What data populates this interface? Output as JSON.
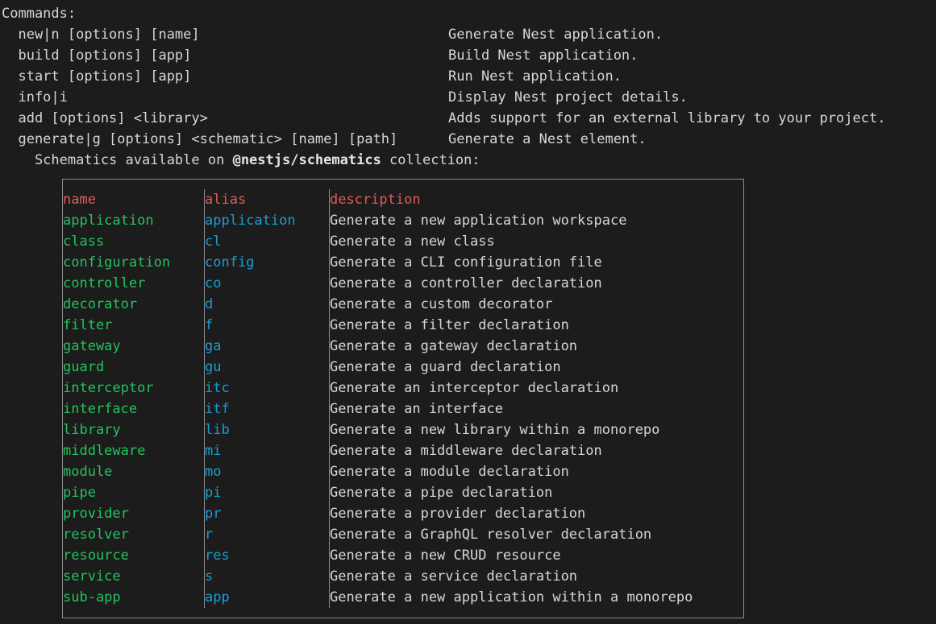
{
  "terminal": {
    "background": "#1c1c1c",
    "foreground": "#d7d7d1",
    "header_color": "#e05c56",
    "name_color": "#21c45d",
    "alias_color": "#169fd6"
  },
  "commands_section": {
    "heading": "Commands:",
    "items": [
      {
        "usage": "  new|n [options] [name]",
        "description": "Generate Nest application."
      },
      {
        "usage": "  build [options] [app]",
        "description": "Build Nest application."
      },
      {
        "usage": "  start [options] [app]",
        "description": "Run Nest application."
      },
      {
        "usage": "  info|i",
        "description": "Display Nest project details."
      },
      {
        "usage": "  add [options] <library>",
        "description": "Adds support for an external library to your project."
      },
      {
        "usage": "  generate|g [options] <schematic> [name] [path]",
        "description": "Generate a Nest element."
      }
    ],
    "schematics_note": {
      "prefix": "    Schematics available on ",
      "package": "@nestjs/schematics",
      "suffix": " collection:"
    }
  },
  "schematics_table": {
    "headers": {
      "name": "name",
      "alias": "alias",
      "description": "description"
    },
    "rows": [
      {
        "name": "application",
        "alias": "application",
        "description": "Generate a new application workspace"
      },
      {
        "name": "class",
        "alias": "cl",
        "description": "Generate a new class"
      },
      {
        "name": "configuration",
        "alias": "config",
        "description": "Generate a CLI configuration file"
      },
      {
        "name": "controller",
        "alias": "co",
        "description": "Generate a controller declaration"
      },
      {
        "name": "decorator",
        "alias": "d",
        "description": "Generate a custom decorator"
      },
      {
        "name": "filter",
        "alias": "f",
        "description": "Generate a filter declaration"
      },
      {
        "name": "gateway",
        "alias": "ga",
        "description": "Generate a gateway declaration"
      },
      {
        "name": "guard",
        "alias": "gu",
        "description": "Generate a guard declaration"
      },
      {
        "name": "interceptor",
        "alias": "itc",
        "description": "Generate an interceptor declaration"
      },
      {
        "name": "interface",
        "alias": "itf",
        "description": "Generate an interface"
      },
      {
        "name": "library",
        "alias": "lib",
        "description": "Generate a new library within a monorepo"
      },
      {
        "name": "middleware",
        "alias": "mi",
        "description": "Generate a middleware declaration"
      },
      {
        "name": "module",
        "alias": "mo",
        "description": "Generate a module declaration"
      },
      {
        "name": "pipe",
        "alias": "pi",
        "description": "Generate a pipe declaration"
      },
      {
        "name": "provider",
        "alias": "pr",
        "description": "Generate a provider declaration"
      },
      {
        "name": "resolver",
        "alias": "r",
        "description": "Generate a GraphQL resolver declaration"
      },
      {
        "name": "resource",
        "alias": "res",
        "description": "Generate a new CRUD resource"
      },
      {
        "name": "service",
        "alias": "s",
        "description": "Generate a service declaration"
      },
      {
        "name": "sub-app",
        "alias": "app",
        "description": "Generate a new application within a monorepo"
      }
    ]
  }
}
